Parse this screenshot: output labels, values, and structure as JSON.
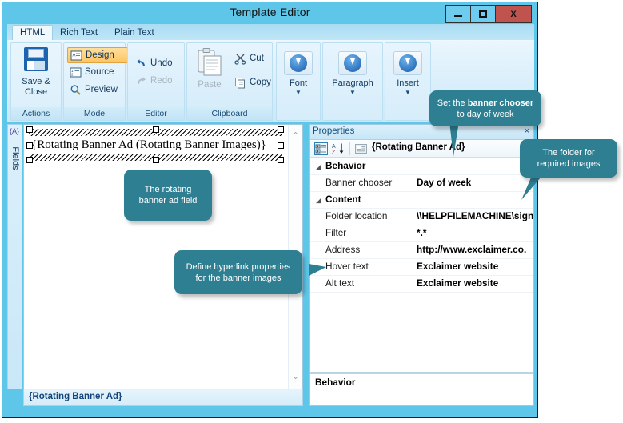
{
  "window": {
    "title": "Template Editor",
    "buttons": {
      "minimize": "minimize-button",
      "maximize": "maximize-button",
      "close": "X"
    }
  },
  "ribbon": {
    "tabs": [
      {
        "label": "HTML",
        "active": true
      },
      {
        "label": "Rich Text",
        "active": false
      },
      {
        "label": "Plain Text",
        "active": false
      }
    ],
    "groups": [
      {
        "name": "Actions",
        "label": "Actions",
        "items": [
          {
            "label": "Save &\nClose",
            "icon": "floppy-disk-icon"
          }
        ]
      },
      {
        "name": "Mode",
        "label": "Mode",
        "items": [
          {
            "label": "Design",
            "icon": "design-view-icon",
            "selected": true
          },
          {
            "label": "Source",
            "icon": "source-view-icon",
            "selected": false
          },
          {
            "label": "Preview",
            "icon": "magnifier-icon",
            "selected": false
          }
        ]
      },
      {
        "name": "Editor",
        "label": "Editor",
        "items": [
          {
            "label": "Undo",
            "icon": "undo-arrow-icon",
            "disabled": false
          },
          {
            "label": "Redo",
            "icon": "redo-arrow-icon",
            "disabled": true
          }
        ]
      },
      {
        "name": "Clipboard",
        "label": "Clipboard",
        "items": [
          {
            "label": "Paste",
            "icon": "clipboard-icon",
            "disabled": true
          },
          {
            "label": "Cut",
            "icon": "scissors-icon",
            "disabled": false
          },
          {
            "label": "Copy",
            "icon": "copy-pages-icon",
            "disabled": false
          }
        ]
      },
      {
        "name": "Font",
        "label": "",
        "items": [
          {
            "label": "Font",
            "icon": "blue-down-arrow-icon"
          }
        ]
      },
      {
        "name": "Paragraph",
        "label": "",
        "items": [
          {
            "label": "Paragraph",
            "icon": "blue-down-arrow-icon"
          }
        ]
      },
      {
        "name": "Insert",
        "label": "",
        "items": [
          {
            "label": "Insert",
            "icon": "blue-down-arrow-icon"
          }
        ]
      }
    ]
  },
  "fields_bar": {
    "label": "Fields",
    "icon_label": "{A}"
  },
  "editor": {
    "field_text": "{Rotating Banner Ad (Rotating Banner Images)}",
    "scroll_up": "⌃",
    "scroll_down": "⌄"
  },
  "status_bar": {
    "text": "{Rotating Banner Ad}"
  },
  "properties": {
    "header_title": "Properties",
    "header_close": "×",
    "toolbar": {
      "categorized_icon": "categorized-view-icon",
      "alphabetical_icon": "sort-alphabetical-icon",
      "pages_icon": "property-pages-icon",
      "selected_object": "{Rotating Banner Ad}"
    },
    "rows": [
      {
        "kind": "category",
        "name": "Behavior",
        "expander": "◢"
      },
      {
        "kind": "property",
        "name": "Banner chooser",
        "value": "Day of week"
      },
      {
        "kind": "category",
        "name": "Content",
        "expander": "◢"
      },
      {
        "kind": "property",
        "name": "Folder location",
        "value": "\\\\HELPFILEMACHINE\\sign"
      },
      {
        "kind": "property",
        "name": "Filter",
        "value": "*.*"
      },
      {
        "kind": "property",
        "name": "Address",
        "value": "http://www.exclaimer.co."
      },
      {
        "kind": "property",
        "name": "Hover text",
        "value": "Exclaimer website"
      },
      {
        "kind": "property",
        "name": "Alt text",
        "value": "Exclaimer website"
      }
    ],
    "description": {
      "title": "Behavior",
      "body": ""
    }
  },
  "callouts": [
    {
      "id": "callout-banner-chooser",
      "parts": [
        {
          "text": "Set the ",
          "bold": false
        },
        {
          "text": "banner",
          "bold": true
        },
        {
          "text": " ",
          "bold": false
        },
        {
          "text": "chooser",
          "bold": true
        },
        {
          "text": " to day of week",
          "bold": false
        }
      ],
      "plain": "Set the banner chooser to day of week"
    },
    {
      "id": "callout-folder",
      "parts": [
        {
          "text": "The folder for required images",
          "bold": false
        }
      ],
      "plain": "The folder for required images"
    },
    {
      "id": "callout-banner-field",
      "parts": [
        {
          "text": "The rotating banner ad field",
          "bold": false
        }
      ],
      "plain": "The rotating banner ad field"
    },
    {
      "id": "callout-hyperlink",
      "parts": [
        {
          "text": "Define hyperlink properties for the banner images",
          "bold": false
        }
      ],
      "plain": "Define hyperlink properties for the banner images"
    }
  ],
  "colors": {
    "window_frame": "#5ec6e8",
    "titlebar": "#5ec6e8",
    "close_button": "#c1534f",
    "callout": "#2e7f92",
    "ribbon_selected": "#fcc566",
    "status_text": "#11427a"
  }
}
